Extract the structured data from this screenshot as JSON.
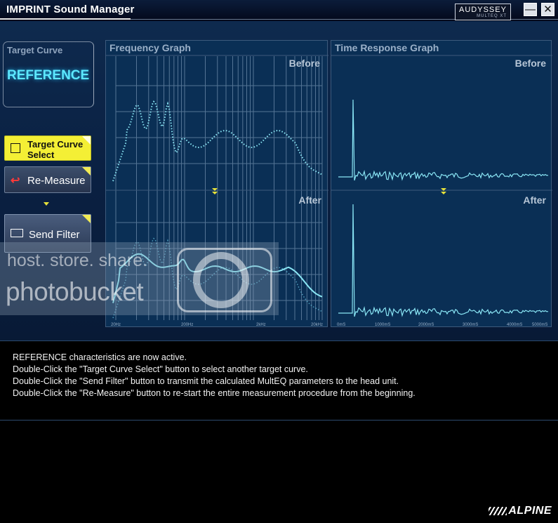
{
  "window": {
    "title": "IMPRINT Sound Manager",
    "logo_main": "AUDYSSEY",
    "logo_sub": "MULTEQ XT",
    "minimize_label": "—",
    "close_label": "✕"
  },
  "target_curve": {
    "label": "Target Curve",
    "value": "REFERENCE"
  },
  "buttons": {
    "target_curve_select_line1": "Target Curve",
    "target_curve_select_line2": "Select",
    "re_measure": "Re-Measure",
    "send_filter": "Send Filter",
    "re_measure_icon": "return-arrow-icon",
    "send_filter_icon": "send-graph-icon",
    "tcs_icon": "curve-select-icon"
  },
  "frequency_graph": {
    "title": "Frequency Graph",
    "before_label": "Before",
    "after_label": "After",
    "x_ticks": [
      "20Hz",
      "200Hz",
      "2kHz",
      "20kHz"
    ]
  },
  "time_response_graph": {
    "title": "Time Response Graph",
    "before_label": "Before",
    "after_label": "After",
    "x_ticks": [
      "0mS",
      "1000mS",
      "2000mS",
      "3000mS",
      "4000mS",
      "5000mS"
    ]
  },
  "status": {
    "lines": [
      "REFERENCE characteristics are now active.",
      "Double-Click the \"Target Curve Select\" button to select another target curve.",
      "Double-Click the \"Send Filter\" button to transmit the calculated MultEQ parameters to the head unit.",
      "Double-Click the \"Re-Measure\" button to re-start the entire measurement procedure from the beginning."
    ]
  },
  "brand": "ALPINE",
  "watermark": {
    "line1": "host. store. share.",
    "line2": "photobucket"
  },
  "colors": {
    "accent": "#5de8ff",
    "trace": "#7fe3f0",
    "button_yellow": "#f4ef35"
  }
}
